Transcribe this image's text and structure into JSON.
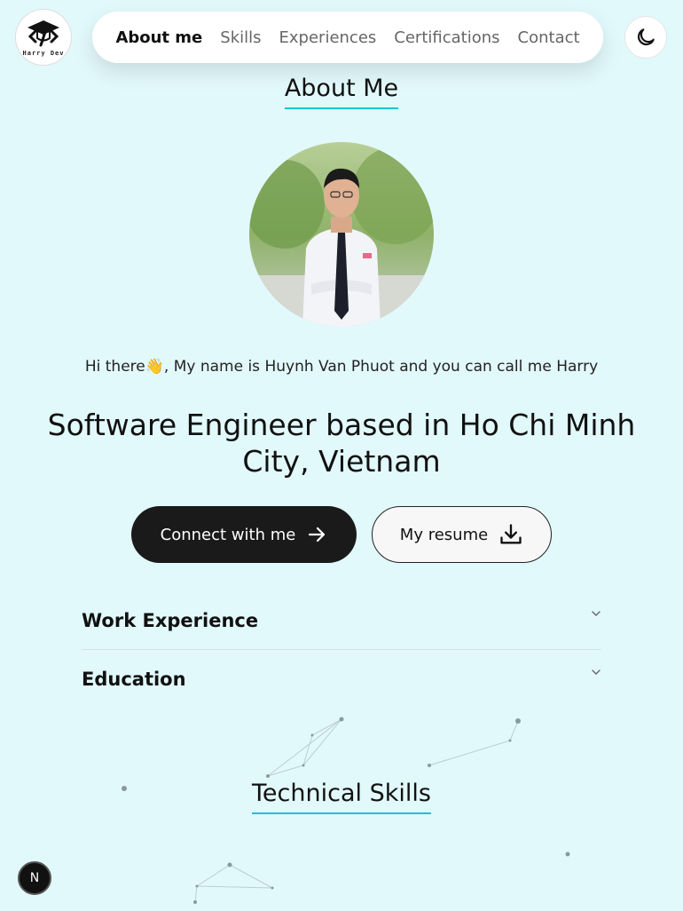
{
  "logo": {
    "text": "Harry Dev"
  },
  "nav": {
    "items": [
      {
        "label": "About me",
        "active": true
      },
      {
        "label": "Skills"
      },
      {
        "label": "Experiences"
      },
      {
        "label": "Certifications"
      },
      {
        "label": "Contact"
      }
    ],
    "theme_icon": "moon-icon"
  },
  "about": {
    "title": "About Me",
    "greeting_pre": "Hi there",
    "greeting_emoji": "👋",
    "greeting_post": ", My name is Huynh Van Phuot and you can call me Harry",
    "headline": "Software Engineer based in Ho Chi Minh City, Vietnam",
    "buttons": {
      "connect_label": "Connect with me",
      "connect_icon": "arrow-right-icon",
      "resume_label": "My resume",
      "resume_icon": "download-icon"
    },
    "accordion": [
      {
        "label": "Work Experience"
      },
      {
        "label": "Education"
      }
    ]
  },
  "skills": {
    "title": "Technical Skills"
  },
  "badge": {
    "label": "N"
  },
  "colors": {
    "background": "#e2f9fb",
    "accent": "#18c3d6",
    "dark": "#1a1a1a"
  }
}
